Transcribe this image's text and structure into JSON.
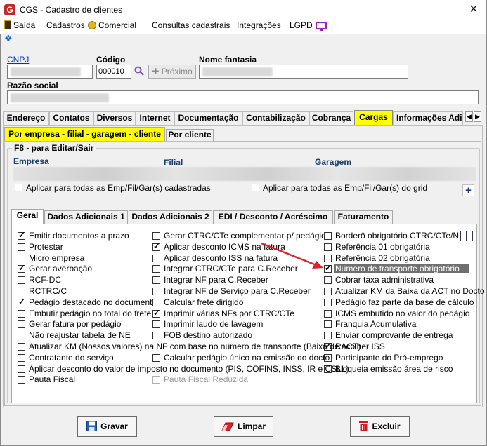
{
  "window": {
    "title": "CGS - Cadastro de clientes",
    "app_icon_letter": "G",
    "close_glyph": "✕"
  },
  "menu": {
    "items": [
      "Saída",
      "Cadastros",
      "Comercial",
      "Consultas cadastrais",
      "Integrações",
      "LGPD"
    ]
  },
  "header": {
    "cnpj_label": "CNPJ",
    "codigo_label": "Código",
    "codigo_value": "000010",
    "nome_fantasia_label": "Nome fantasia",
    "proximo_label": "Próximo",
    "razao_social_label": "Razão social"
  },
  "main_tabs": [
    "Endereço",
    "Contatos",
    "Diversos",
    "Internet",
    "Documentação",
    "Contabilização",
    "Cobrança",
    "Cargas",
    "Informações Adic"
  ],
  "sub_tabs": [
    "Por empresa - filial - garagem - cliente",
    "Por cliente"
  ],
  "group": {
    "title": "F8 - para Editar/Sair",
    "col_empresa": "Empresa",
    "col_filial": "Filial",
    "col_garagem": "Garagem",
    "apply_all_left": "Aplicar para todas as Emp/Fil/Gar(s) cadastradas",
    "apply_all_right": "Aplicar para todas as Emp/Fil/Gar(s) do grid",
    "plus_glyph": "+"
  },
  "inner_tabs": [
    "Geral",
    "Dados Adicionais 1",
    "Dados Adicionais 2",
    "EDI / Desconto / Acréscimo",
    "Faturamento"
  ],
  "options_col1": [
    {
      "label": "Emitir documentos a prazo",
      "checked": true
    },
    {
      "label": "Protestar",
      "checked": false
    },
    {
      "label": "Micro empresa",
      "checked": false
    },
    {
      "label": "Gerar averbação",
      "checked": true
    },
    {
      "label": "RCF-DC",
      "checked": false
    },
    {
      "label": "RCTRC/C",
      "checked": false
    },
    {
      "label": "Pedágio destacado no documento",
      "checked": true
    },
    {
      "label": "Embutir pedágio no total do frete",
      "checked": false
    },
    {
      "label": "Gerar fatura por pedágio",
      "checked": false
    },
    {
      "label": "Não reajustar tabela de NE",
      "checked": false
    }
  ],
  "options_col2": [
    {
      "label": "Gerar CTRC/CTe complementar p/ pedágio",
      "checked": false
    },
    {
      "label": "Aplicar desconto ICMS na fatura",
      "checked": true
    },
    {
      "label": "Aplicar desconto ISS na fatura",
      "checked": false
    },
    {
      "label": "Integrar CTRC/CTe para C.Receber",
      "checked": false
    },
    {
      "label": "Integrar NF para C.Receber",
      "checked": false
    },
    {
      "label": "Integrar NF de Serviço para C.Receber",
      "checked": false
    },
    {
      "label": "Calcular frete dirigido",
      "checked": false
    },
    {
      "label": "Imprimir várias NFs por CTRC/CTe",
      "checked": true
    },
    {
      "label": "Imprimir laudo de lavagem",
      "checked": false
    },
    {
      "label": "FOB destino autorizado",
      "checked": false
    }
  ],
  "options_col3": [
    {
      "label": "Borderô obrigatório  CTRC/CTe/NF",
      "checked": false
    },
    {
      "label": "Referência 01 obrigatória",
      "checked": false
    },
    {
      "label": "Referência 02 obrigatória",
      "checked": false
    },
    {
      "label": "Número de transporte obrigatório",
      "checked": true
    },
    {
      "label": "Cobrar taxa administrativa",
      "checked": false
    },
    {
      "label": "Atualizar KM da Baixa da ACT no Docto",
      "checked": false
    },
    {
      "label": "Pedágio faz parte da base de cálculo",
      "checked": false
    },
    {
      "label": "ICMS embutido no valor do pedágio",
      "checked": false
    },
    {
      "label": "Franquia Acumulativa",
      "checked": false
    },
    {
      "label": "Enviar comprovante de entrega",
      "checked": false
    },
    {
      "label": "Recolher ISS",
      "checked": true
    },
    {
      "label": "Participante do Pró-emprego",
      "checked": false
    },
    {
      "label": "Bloqueia emissão área de risco",
      "checked": false
    }
  ],
  "options_wide": [
    {
      "label": "Atualizar KM (Nossos valores) na NF com base no número de transporte (Baixa de ACT)",
      "checked": false
    },
    {
      "label": "Contratante do serviço",
      "checked": false
    },
    {
      "label": "Aplicar desconto do valor de imposto no documento (PIS, COFINS, INSS, IR e CSLL)",
      "checked": false
    },
    {
      "label": "Pauta Fiscal",
      "checked": false
    }
  ],
  "options_extra": [
    {
      "label": "Calcular pedágio único na emissão do docto",
      "checked": false
    },
    {
      "label": "Pauta Fiscal Reduzida",
      "checked": false,
      "disabled": true
    }
  ],
  "footer": {
    "gravar": "Gravar",
    "limpar": "Limpar",
    "excluir": "Excluir"
  },
  "colors": {
    "highlight_tab": "#ffff00",
    "arrow": "#e0202a",
    "row_highlight": "#6f6f6f"
  }
}
